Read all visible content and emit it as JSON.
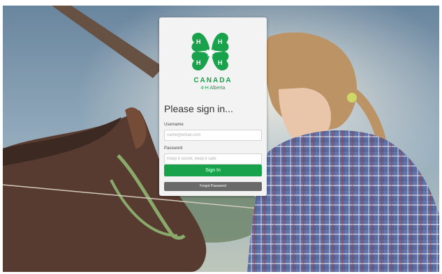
{
  "brand": {
    "name": "CANADA",
    "region": "4-H Alberta",
    "accent_color": "#17a24b"
  },
  "form": {
    "heading": "Please sign in...",
    "username": {
      "label": "Username",
      "placeholder": "name@email.com",
      "value": ""
    },
    "password": {
      "label": "Password",
      "placeholder": "Keep it secret, keep it safe",
      "value": ""
    },
    "signin_label": "Sign In",
    "forgot_label": "Forgot Password"
  },
  "background": {
    "icon": "horse-and-girl-photo"
  },
  "icons": {
    "logo": "four-leaf-clover-maple-leaf-icon"
  }
}
